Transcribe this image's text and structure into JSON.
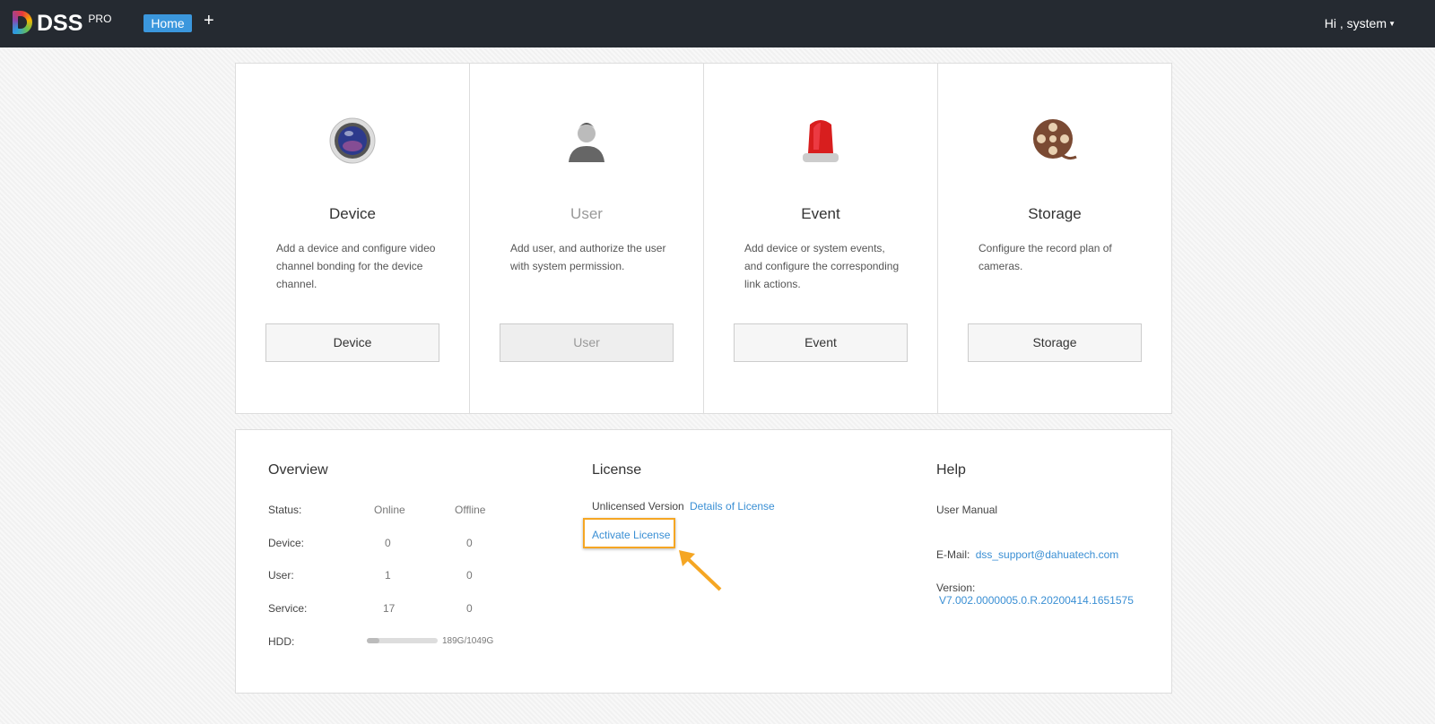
{
  "header": {
    "logo": "DSS",
    "logo_sup": "PRO",
    "tab": "Home",
    "add": "+",
    "user": "Hi , system"
  },
  "cards": [
    {
      "title": "Device",
      "desc": "Add a device and configure video channel bonding for the device channel.",
      "button": "Device",
      "icon": "camera-icon"
    },
    {
      "title": "User",
      "desc": "Add user, and authorize the user with system permission.",
      "button": "User",
      "icon": "user-icon"
    },
    {
      "title": "Event",
      "desc": "Add device or system events, and configure the corresponding link actions.",
      "button": "Event",
      "icon": "alarm-light-icon"
    },
    {
      "title": "Storage",
      "desc": "Configure the record plan of cameras.",
      "button": "Storage",
      "icon": "film-reel-icon"
    }
  ],
  "overview": {
    "title": "Overview",
    "status": "Status:",
    "online": "Online",
    "offline": "Offline",
    "rows": [
      {
        "label": "Device:",
        "online": "0",
        "offline": "0"
      },
      {
        "label": "User:",
        "online": "1",
        "offline": "0"
      },
      {
        "label": "Service:",
        "online": "17",
        "offline": "0"
      }
    ],
    "hdd_label": "HDD:",
    "hdd_value": "189G/1049G",
    "hdd_fraction": 0.18
  },
  "license": {
    "title": "License",
    "version": "Unlicensed Version",
    "details": "Details of License",
    "activate": "Activate License"
  },
  "help": {
    "title": "Help",
    "manual": "User Manual",
    "email_label": "E-Mail:",
    "email": "dss_support@dahuatech.com",
    "version_label": "Version:",
    "version": "V7.002.0000005.0.R.20200414.1651575"
  },
  "colors": {
    "accent": "#3b97dd",
    "highlight": "#f5a623"
  }
}
